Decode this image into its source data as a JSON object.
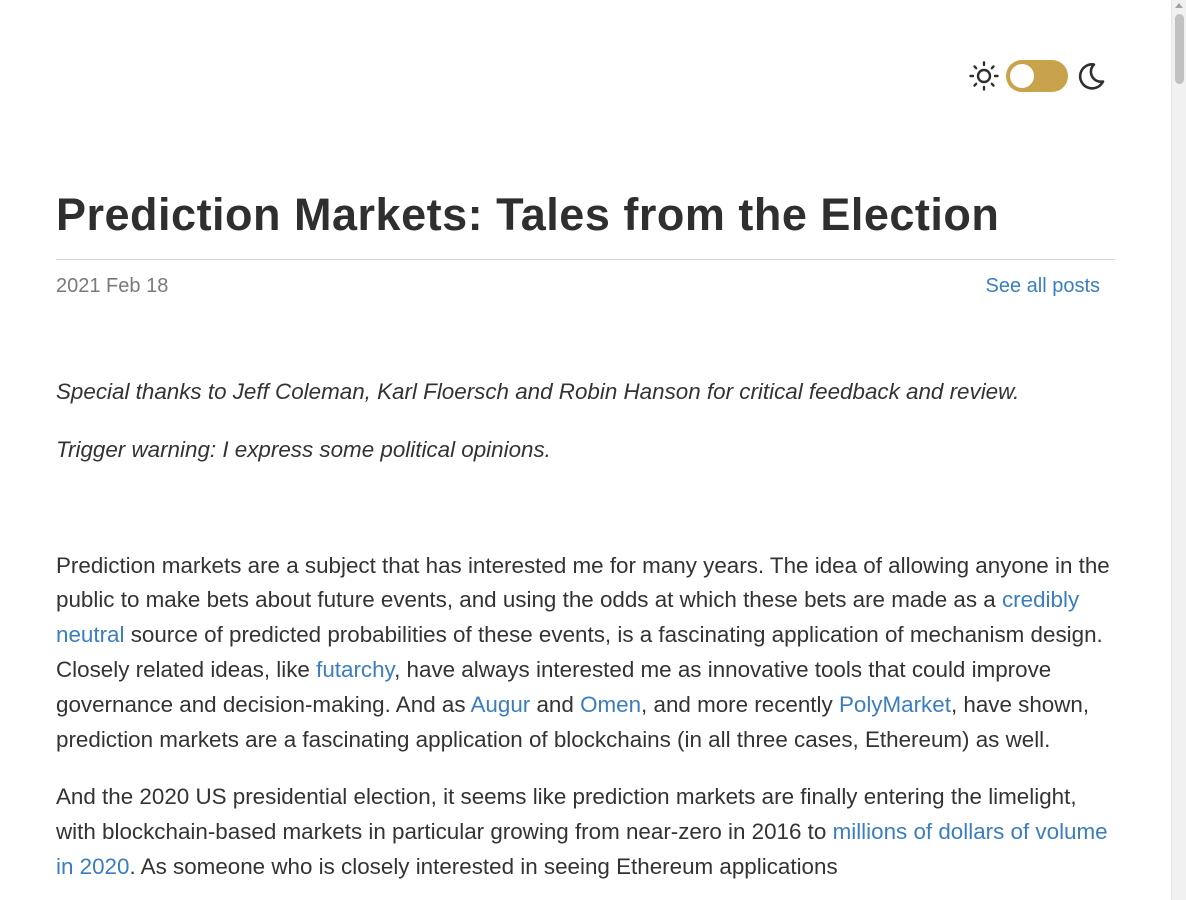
{
  "header": {
    "theme_toggle": {
      "state": "light",
      "accent": "#c9a24c",
      "left_icon": "sun-icon",
      "right_icon": "moon-icon"
    }
  },
  "post": {
    "title": "Prediction Markets: Tales from the Election",
    "date": "2021 Feb 18",
    "see_all_label": "See all posts",
    "thanks": "Special thanks to Jeff Coleman, Karl Floersch and Robin Hanson for critical feedback and review.",
    "warning": "Trigger warning: I express some political opinions.",
    "p1": {
      "t1": "Prediction markets are a subject that has interested me for many years. The idea of allowing anyone in the public to make bets about future events, and using the odds at which these bets are made as a ",
      "link1": "credibly neutral",
      "t2": " source of predicted probabilities of these events, is a fascinating application of mechanism design. Closely related ideas, like ",
      "link2": "futarchy",
      "t3": ", have always interested me as innovative tools that could improve governance and decision-making. And as ",
      "link3": "Augur",
      "t4": " and ",
      "link4": "Omen",
      "t5": ", and more recently ",
      "link5": "PolyMarket",
      "t6": ", have shown, prediction markets are a fascinating application of blockchains (in all three cases, Ethereum) as well."
    },
    "p2": {
      "t1": "And the 2020 US presidential election, it seems like prediction markets are finally entering the limelight, with blockchain-based markets in particular growing from near-zero in 2016 to ",
      "link1": "millions of dollars of volume in 2020",
      "t2": ". As someone who is closely interested in seeing Ethereum applications"
    }
  },
  "colors": {
    "link": "#3a7ebf",
    "text": "#333333",
    "muted": "#7a7a7a"
  }
}
